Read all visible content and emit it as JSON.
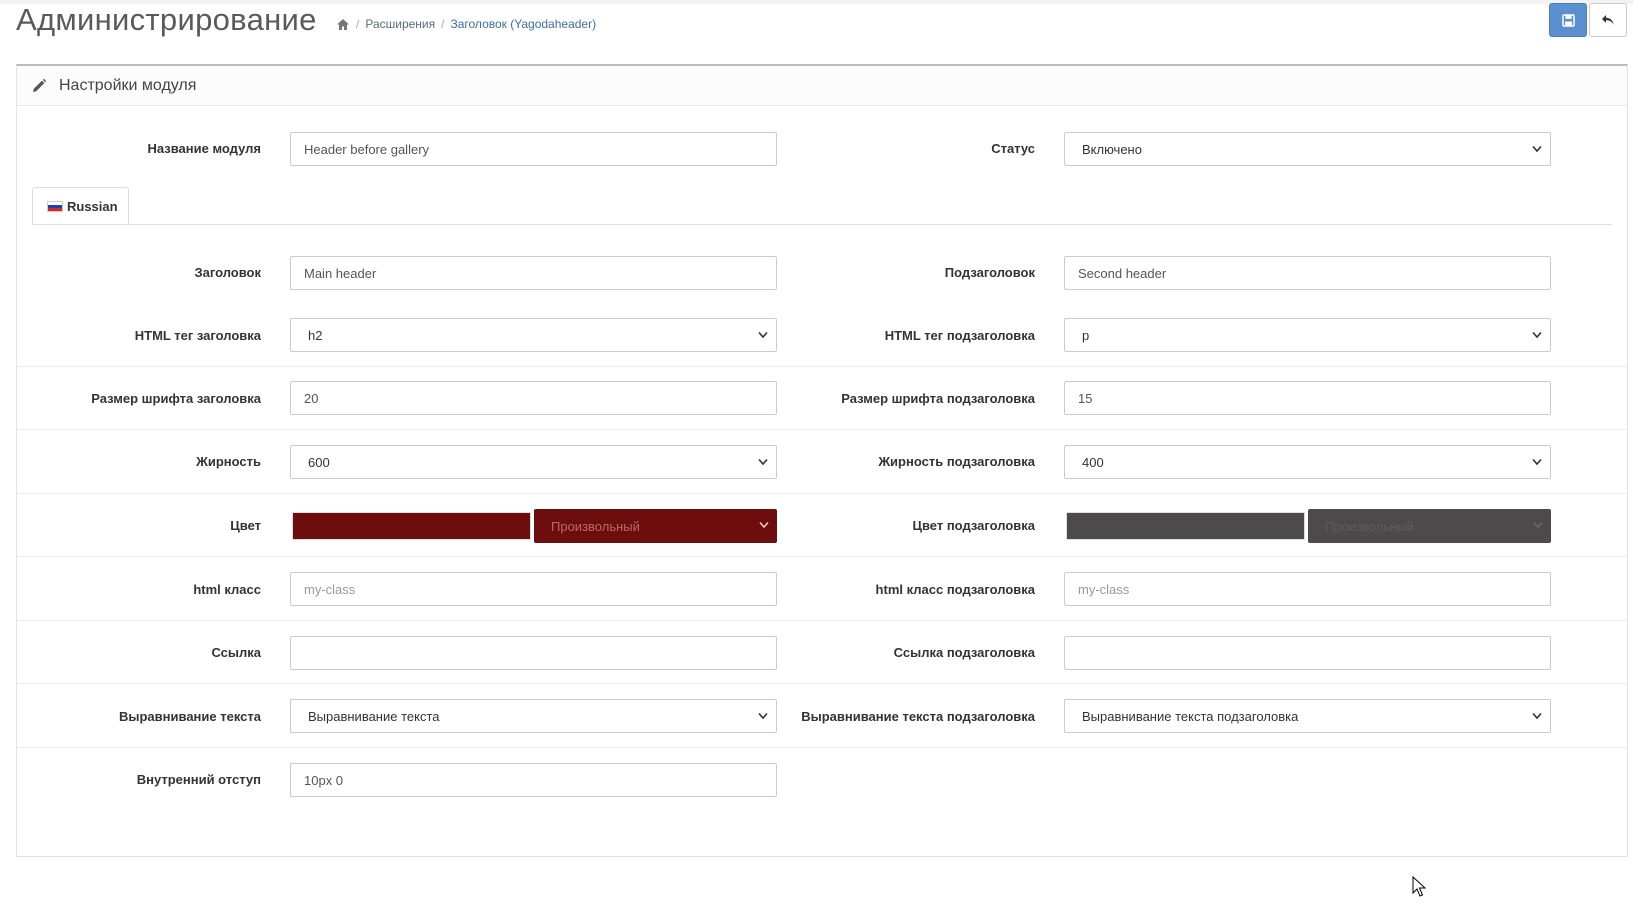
{
  "header": {
    "title": "Администрирование",
    "breadcrumb": [
      "Расширения",
      "Заголовок (Yagodaheader)"
    ]
  },
  "panel": {
    "title": "Настройки модуля"
  },
  "module": {
    "name_label": "Название модуля",
    "name_value": "Header before gallery",
    "status_label": "Статус",
    "status_value": "Включено"
  },
  "tab": {
    "label": "Russian"
  },
  "fields": {
    "heading_label": "Заголовок",
    "heading_value": "Main header",
    "subheading_label": "Подзаголовок",
    "subheading_value": "Second header",
    "heading_tag_label": "HTML тег заголовка",
    "heading_tag_value": "h2",
    "subheading_tag_label": "HTML тег подзаголовка",
    "subheading_tag_value": "p",
    "heading_size_label": "Размер шрифта заголовка",
    "heading_size_value": "20",
    "subheading_size_label": "Размер шрифта подзаголовка",
    "subheading_size_value": "15",
    "weight_label": "Жирность",
    "weight_value": "600",
    "subheading_weight_label": "Жирность подзаголовка",
    "subheading_weight_value": "400",
    "color_label": "Цвет",
    "color_value": "Произвольный",
    "color_hex": "#6e0d0d",
    "subheading_color_label": "Цвет подзаголовка",
    "subheading_color_value": "Произвольный",
    "subheading_color_hex": "#4d4a4b",
    "class_label": "html класс",
    "class_placeholder": "my-class",
    "subheading_class_label": "html класс подзаголовка",
    "subheading_class_placeholder": "my-class",
    "link_label": "Ссылка",
    "link_value": "",
    "subheading_link_label": "Ссылка подзаголовка",
    "subheading_link_value": "",
    "align_label": "Выравнивание текста",
    "align_value": "Выравнивание текста",
    "subheading_align_label": "Выравнивание текста подзаголовка",
    "subheading_align_value": "Выравнивание текста подзаголовка",
    "padding_label": "Внутренний отступ",
    "padding_value": "10px 0"
  },
  "colors": {
    "primary_button": "#5b8fd0",
    "link": "#3c6fa7"
  }
}
